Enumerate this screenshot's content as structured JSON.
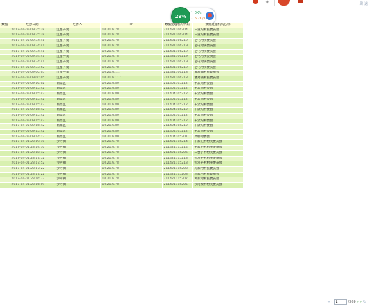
{
  "top_right_text": "录 退",
  "top_box_text": "水",
  "net": {
    "percent": "29%",
    "up": "↑ 0K/s",
    "down": "↓ 6.2K/s"
  },
  "table": {
    "headers": [
      "数据",
      "经办日期",
      "经办人",
      "IP",
      "数据处理机构代码",
      "数据处理机构名称"
    ],
    "rows": [
      {
        "time": "2017-04-05 09:35:28",
        "person": "红星子街",
        "ip": "10.21.9.78",
        "code": "211481106204",
        "org": "三道沟村民委员会"
      },
      {
        "time": "2017-04-05 09:35:28",
        "person": "红星子街",
        "ip": "10.21.9.78",
        "code": "211481106204",
        "org": "三道沟村民委员会"
      },
      {
        "time": "2017-04-05 09:34:41",
        "person": "红星子街",
        "ip": "10.21.9.78",
        "code": "211481106219",
        "org": "苗屯村民委员会"
      },
      {
        "time": "2017-04-05 09:34:41",
        "person": "红星子街",
        "ip": "10.21.9.78",
        "code": "211481106219",
        "org": "苗屯村民委员会"
      },
      {
        "time": "2017-04-05 09:34:41",
        "person": "红星子街",
        "ip": "10.21.9.78",
        "code": "211481106219",
        "org": "苗屯村民委员会"
      },
      {
        "time": "2017-04-05 09:34:41",
        "person": "红星子街",
        "ip": "10.21.9.78",
        "code": "211481106219",
        "org": "苗屯村民委员会"
      },
      {
        "time": "2017-04-05 09:34:41",
        "person": "红星子街",
        "ip": "10.21.9.78",
        "code": "211481106219",
        "org": "苗屯村民委员会"
      },
      {
        "time": "2017-04-05 09:33:52",
        "person": "红星子街",
        "ip": "10.21.9.78",
        "code": "211481106219",
        "org": "苗屯村民委员会"
      },
      {
        "time": "2017-04-05 09:00:05",
        "person": "红星子街",
        "ip": "10.21.9.117",
        "code": "211481106218",
        "org": "潘窝铺村民委员会"
      },
      {
        "time": "2017-04-05 09:00:05",
        "person": "红星子街",
        "ip": "10.21.9.117",
        "code": "211481106218",
        "org": "潘窝铺村民委员会"
      },
      {
        "time": "2017-04-05 09:16:02",
        "person": "南票区",
        "ip": "10.21.9.80",
        "code": "211404105212",
        "org": "干沢沟村委会"
      },
      {
        "time": "2017-04-05 09:15:42",
        "person": "南票区",
        "ip": "10.21.9.80",
        "code": "211404105212",
        "org": "干沢沟村委会"
      },
      {
        "time": "2017-04-05 09:15:42",
        "person": "南票区",
        "ip": "10.21.9.80",
        "code": "211404105212",
        "org": "干沢沟村委会"
      },
      {
        "time": "2017-04-05 09:15:42",
        "person": "南票区",
        "ip": "10.21.9.80",
        "code": "211404105212",
        "org": "干沢沟村委会"
      },
      {
        "time": "2017-04-05 09:15:42",
        "person": "南票区",
        "ip": "10.21.9.80",
        "code": "211404105212",
        "org": "干沢沟村委会"
      },
      {
        "time": "2017-04-05 09:15:42",
        "person": "南票区",
        "ip": "10.21.9.80",
        "code": "211404105212",
        "org": "干沢沟村委会"
      },
      {
        "time": "2017-04-05 09:15:42",
        "person": "南票区",
        "ip": "10.21.9.80",
        "code": "211404105212",
        "org": "干沢沟村委会"
      },
      {
        "time": "2017-04-05 09:15:42",
        "person": "南票区",
        "ip": "10.21.9.80",
        "code": "211404105212",
        "org": "干沢沟村委会"
      },
      {
        "time": "2017-04-05 09:15:42",
        "person": "南票区",
        "ip": "10.21.9.80",
        "code": "211404105212",
        "org": "干沢沟村委会"
      },
      {
        "time": "2017-04-05 09:15:42",
        "person": "南票区",
        "ip": "10.21.9.80",
        "code": "211404105212",
        "org": "干沢沟村委会"
      },
      {
        "time": "2017-04-05 09:14:13",
        "person": "南票区",
        "ip": "10.21.9.80",
        "code": "211404105201",
        "org": "高桥村委会"
      },
      {
        "time": "2017-04-01 23:19:10",
        "person": "沙河镇",
        "ip": "10.21.9.78",
        "code": "211421115214",
        "org": "干家屯村村民委员会"
      },
      {
        "time": "2017-04-01 23:19:10",
        "person": "沙河镇",
        "ip": "10.21.9.78",
        "code": "211421115214",
        "org": "干家屯村村民委员会"
      },
      {
        "time": "2017-04-01 23:18:12",
        "person": "沙河镇",
        "ip": "10.21.9.78",
        "code": "211421115206",
        "org": "三合子村村民委员会"
      },
      {
        "time": "2017-04-01 23:17:52",
        "person": "沙河镇",
        "ip": "10.21.9.78",
        "code": "211421115213",
        "org": "恒河子村村民委员会"
      },
      {
        "time": "2017-04-01 23:17:52",
        "person": "沙河镇",
        "ip": "10.21.9.78",
        "code": "211421115213",
        "org": "恒河子村村民委员会"
      },
      {
        "time": "2017-04-01 23:17:22",
        "person": "沙河镇",
        "ip": "10.21.9.78",
        "code": "211421115203",
        "org": "冯家村村民委员会"
      },
      {
        "time": "2017-04-01 23:17:22",
        "person": "沙河镇",
        "ip": "10.21.9.78",
        "code": "211421115203",
        "org": "冯家村村民委员会"
      },
      {
        "time": "2017-04-01 23:16:37",
        "person": "沙河镇",
        "ip": "10.21.9.78",
        "code": "211421115207",
        "org": "简家村村民委员会"
      },
      {
        "time": "2017-04-01 23:16:09",
        "person": "沙河镇",
        "ip": "10.21.9.78",
        "code": "211421115205",
        "org": "沙河渡村村民委员会"
      }
    ]
  },
  "pager": {
    "first": "«",
    "prev": "‹",
    "page": "1",
    "total": "/369",
    "next": "›",
    "last": "»",
    "refresh": "↻"
  },
  "colors": {
    "row_a": "#e8f6c8",
    "row_b": "#d8f0b0",
    "header": "#fdfdd9",
    "net_green": "#1e9a55"
  }
}
